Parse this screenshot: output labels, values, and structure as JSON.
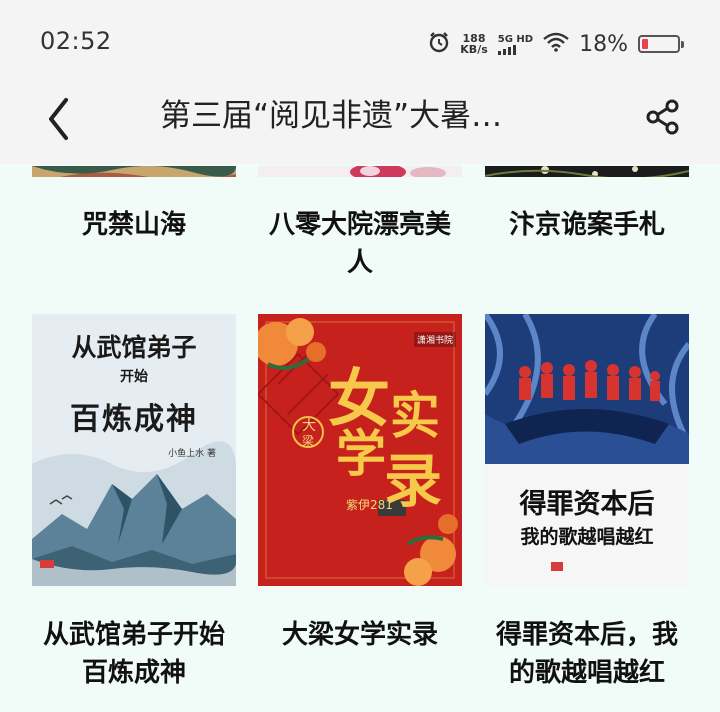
{
  "status": {
    "time": "02:52",
    "net_speed_value": "188",
    "net_speed_unit": "KB/s",
    "network_type": "5G HD",
    "battery_percent": "18%",
    "battery_level": 0.18
  },
  "header": {
    "title": "第三届“阅见非遗”大暑…"
  },
  "books_row1": [
    {
      "title": "咒禁山海"
    },
    {
      "title": "八零大院漂亮美人"
    },
    {
      "title": "汴京诡案手札"
    }
  ],
  "books_row2": [
    {
      "title": "从武馆弟子开始百炼成神",
      "cover_line1": "从武馆弟子",
      "cover_line2": "开始",
      "cover_line3": "百炼成神",
      "cover_author": "小鱼上水 著"
    },
    {
      "title": "大梁女学实录",
      "cover_big1": "女",
      "cover_big2": "学",
      "cover_big3": "实",
      "cover_big4": "录",
      "cover_seal1": "大",
      "cover_seal2": "梁",
      "cover_author": "紫伊281",
      "cover_publisher": "潇湘书院"
    },
    {
      "title": "得罪资本后，我的歌越唱越红",
      "cover_line1": "得罪资本后",
      "cover_line2": "我的歌越唱越红"
    }
  ],
  "colors": {
    "page_bg": "#f1fbf7",
    "bar_bg": "#f4f4f4",
    "battery_red": "#e8434a"
  }
}
